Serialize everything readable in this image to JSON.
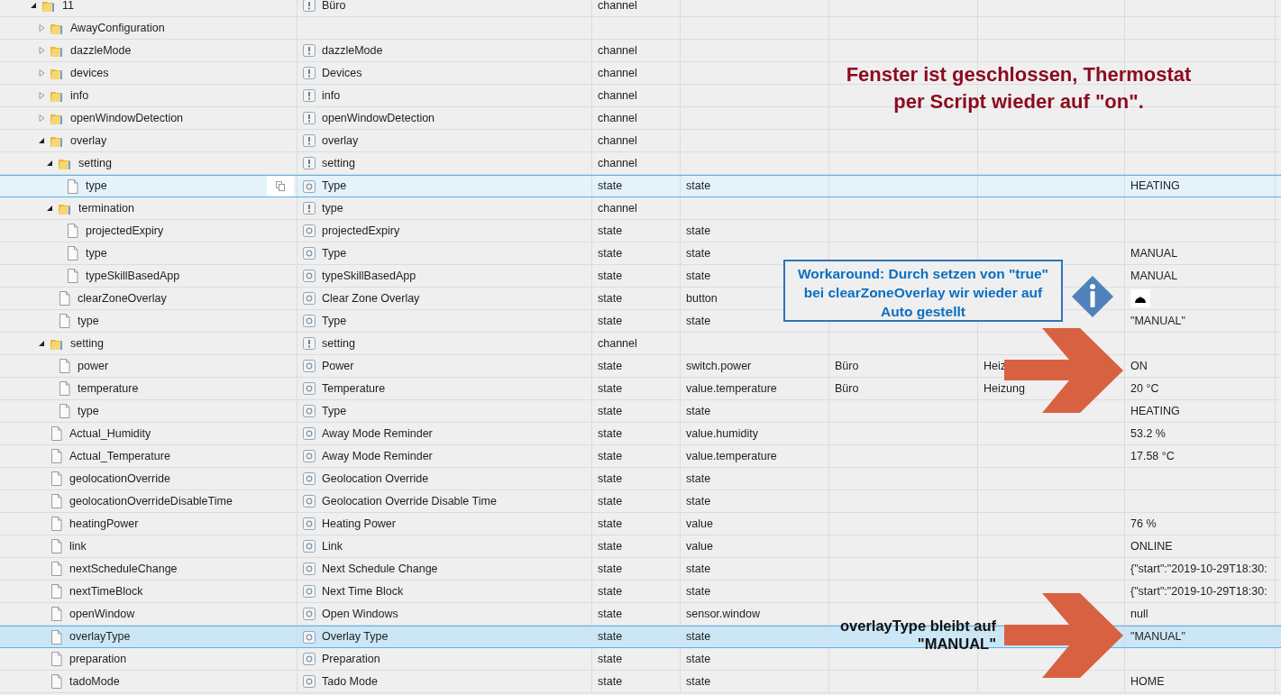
{
  "tree": [
    {
      "name": "11",
      "kind": "folder",
      "expanded": true,
      "selected": false,
      "title": "Büro",
      "type": "channel",
      "children": [
        {
          "name": "AwayConfiguration",
          "kind": "folder",
          "expanded": false,
          "selected": false
        },
        {
          "name": "dazzleMode",
          "kind": "folder",
          "expanded": false,
          "selected": false,
          "title": "dazzleMode",
          "type": "channel"
        },
        {
          "name": "devices",
          "kind": "folder",
          "expanded": false,
          "selected": false,
          "title": "Devices",
          "type": "channel"
        },
        {
          "name": "info",
          "kind": "folder",
          "expanded": false,
          "selected": false,
          "title": "info",
          "type": "channel"
        },
        {
          "name": "openWindowDetection",
          "kind": "folder",
          "expanded": false,
          "selected": false,
          "title": "openWindowDetection",
          "type": "channel"
        },
        {
          "name": "overlay",
          "kind": "folder",
          "expanded": true,
          "selected": false,
          "title": "overlay",
          "type": "channel",
          "children": [
            {
              "name": "setting",
              "kind": "folder",
              "expanded": true,
              "selected": false,
              "title": "setting",
              "type": "channel",
              "children": [
                {
                  "name": "type",
                  "kind": "state",
                  "selected": false,
                  "hovered": true,
                  "title": "Type",
                  "type": "state",
                  "role": "state",
                  "value": "HEATING"
                }
              ]
            },
            {
              "name": "termination",
              "kind": "folder",
              "expanded": true,
              "selected": false,
              "title": "type",
              "type": "channel",
              "children": [
                {
                  "name": "projectedExpiry",
                  "kind": "state",
                  "selected": false,
                  "title": "projectedExpiry",
                  "type": "state",
                  "role": "state"
                },
                {
                  "name": "type",
                  "kind": "state",
                  "selected": false,
                  "title": "Type",
                  "type": "state",
                  "role": "state",
                  "value": "MANUAL"
                },
                {
                  "name": "typeSkillBasedApp",
                  "kind": "state",
                  "selected": false,
                  "title": "typeSkillBasedApp",
                  "type": "state",
                  "role": "state",
                  "value": "MANUAL"
                }
              ]
            },
            {
              "name": "clearZoneOverlay",
              "kind": "button",
              "selected": false,
              "title": "Clear Zone Overlay",
              "type": "state",
              "role": "button"
            },
            {
              "name": "type",
              "kind": "state",
              "selected": false,
              "title": "Type",
              "type": "state",
              "role": "state",
              "value": "\"MANUAL\""
            }
          ]
        },
        {
          "name": "setting",
          "kind": "folder",
          "expanded": true,
          "selected": false,
          "title": "setting",
          "type": "channel",
          "children": [
            {
              "name": "power",
              "kind": "state",
              "selected": false,
              "title": "Power",
              "type": "state",
              "role": "switch.power",
              "room": "Büro",
              "function": "Heiz",
              "value": "ON"
            },
            {
              "name": "temperature",
              "kind": "state",
              "selected": false,
              "title": "Temperature",
              "type": "state",
              "role": "value.temperature",
              "room": "Büro",
              "function": "Heizung",
              "value": "20 °C"
            },
            {
              "name": "type",
              "kind": "state",
              "selected": false,
              "title": "Type",
              "type": "state",
              "role": "state",
              "value": "HEATING"
            }
          ]
        },
        {
          "name": "Actual_Humidity",
          "kind": "state",
          "selected": false,
          "title": "Away Mode Reminder",
          "type": "state",
          "role": "value.humidity",
          "value": "53.2 %"
        },
        {
          "name": "Actual_Temperature",
          "kind": "state",
          "selected": false,
          "title": "Away Mode Reminder",
          "type": "state",
          "role": "value.temperature",
          "value": "17.58 °C"
        },
        {
          "name": "geolocationOverride",
          "kind": "state",
          "selected": false,
          "title": "Geolocation Override",
          "type": "state",
          "role": "state"
        },
        {
          "name": "geolocationOverrideDisableTime",
          "kind": "state",
          "selected": false,
          "title": "Geolocation Override Disable Time",
          "type": "state",
          "role": "state"
        },
        {
          "name": "heatingPower",
          "kind": "state",
          "selected": false,
          "title": "Heating Power",
          "type": "state",
          "role": "value",
          "value": "76 %"
        },
        {
          "name": "link",
          "kind": "state",
          "selected": false,
          "title": "Link",
          "type": "state",
          "role": "value",
          "value": "ONLINE"
        },
        {
          "name": "nextScheduleChange",
          "kind": "state",
          "selected": false,
          "title": "Next Schedule Change",
          "type": "state",
          "role": "state",
          "value": "{\"start\":\"2019-10-29T18:30:"
        },
        {
          "name": "nextTimeBlock",
          "kind": "state",
          "selected": false,
          "title": "Next Time Block",
          "type": "state",
          "role": "state",
          "value": "{\"start\":\"2019-10-29T18:30:"
        },
        {
          "name": "openWindow",
          "kind": "state",
          "selected": false,
          "title": "Open Windows",
          "type": "state",
          "role": "sensor.window",
          "value": "null"
        },
        {
          "name": "overlayType",
          "kind": "state",
          "selected": true,
          "title": "Overlay Type",
          "type": "state",
          "role": "state",
          "value": "\"MANUAL\""
        },
        {
          "name": "preparation",
          "kind": "state",
          "selected": false,
          "title": "Preparation",
          "type": "state",
          "role": "state"
        },
        {
          "name": "tadoMode",
          "kind": "state",
          "selected": false,
          "title": "Tado Mode",
          "type": "state",
          "role": "state",
          "value": "HOME"
        }
      ]
    }
  ],
  "annotations": [
    {
      "kind": "heading",
      "text": "Fenster ist geschlossen, Thermostat\nper Script wieder auf \"on\"."
    },
    {
      "kind": "callout",
      "text": "Workaround: Durch setzen von \"true\"\nbei clearZoneOverlay wir wieder auf\nAuto gestellt"
    },
    {
      "kind": "note",
      "text": "overlayType bleibt auf\n\"MANUAL\""
    }
  ]
}
